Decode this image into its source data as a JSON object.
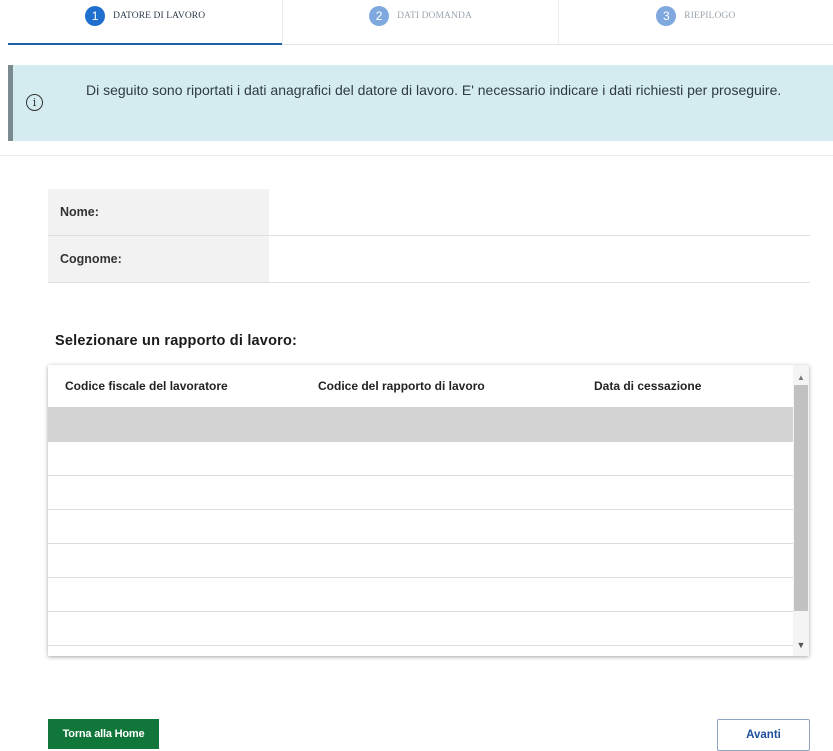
{
  "stepper": {
    "steps": [
      {
        "number": "1",
        "label": "DATORE DI LAVORO",
        "active": true
      },
      {
        "number": "2",
        "label": "DATI DOMANDA",
        "active": false
      },
      {
        "number": "3",
        "label": "RIEPILOGO",
        "active": false
      }
    ]
  },
  "alert": {
    "icon": "info-icon",
    "text": "Di seguito sono riportati i dati anagrafici del datore di lavoro. E' necessario indicare i dati richiesti per proseguire."
  },
  "employer": {
    "nome_label": "Nome:",
    "nome_value": "",
    "cognome_label": "Cognome:",
    "cognome_value": ""
  },
  "selection": {
    "title": "Selezionare un rapporto di lavoro:"
  },
  "grid": {
    "columns": [
      "Codice fiscale del lavoratore",
      "Codice del rapporto di lavoro",
      "Data di cessazione"
    ],
    "rows": [
      [
        "",
        "",
        ""
      ],
      [
        "",
        "",
        ""
      ],
      [
        "",
        "",
        ""
      ],
      [
        "",
        "",
        ""
      ],
      [
        "",
        "",
        ""
      ],
      [
        "",
        "",
        ""
      ],
      [
        "",
        "",
        ""
      ]
    ],
    "selected_row": 0
  },
  "colors": {
    "primary_green": "#11763a",
    "primary_blue": "#1f6fcf",
    "alert_bg": "#d4ecef"
  },
  "buttons": {
    "home_label": "Torna alla Home",
    "next_label": "Avanti"
  }
}
